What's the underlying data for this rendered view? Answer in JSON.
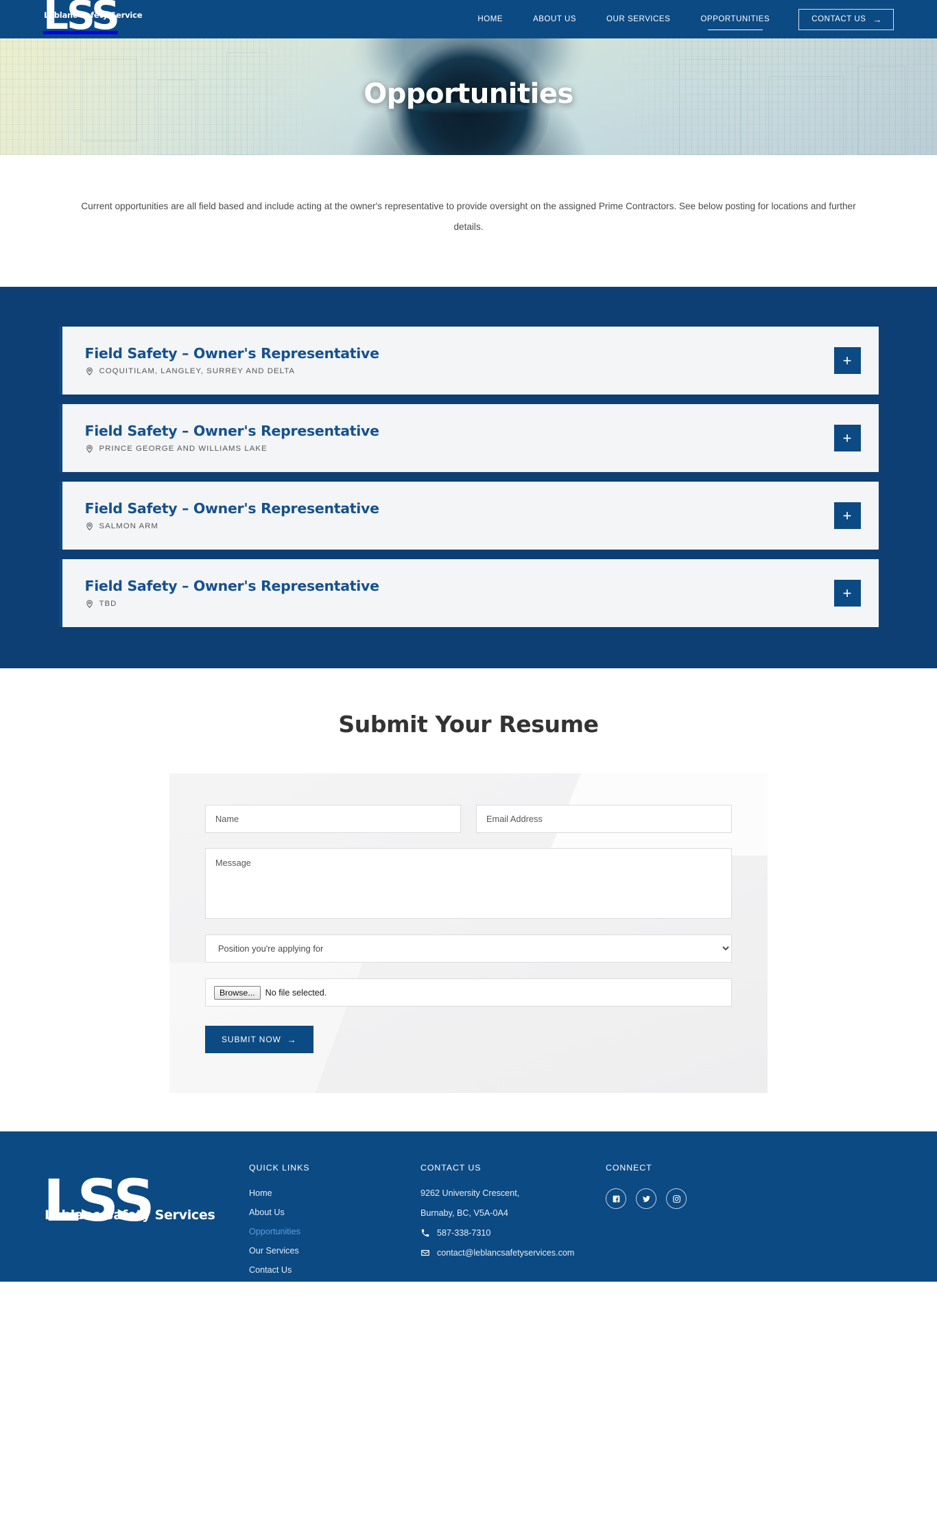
{
  "header": {
    "logo_main": "LSS",
    "logo_sub": "Leblanc Safety Services",
    "nav": [
      {
        "label": "HOME",
        "active": false
      },
      {
        "label": "ABOUT US",
        "active": false
      },
      {
        "label": "OUR SERVICES",
        "active": false
      },
      {
        "label": "OPPORTUNITIES",
        "active": true
      }
    ],
    "cta_label": "CONTACT US",
    "cta_arrow": "→"
  },
  "hero": {
    "title": "Opportunities"
  },
  "intro": {
    "paragraph": "Current opportunities are all field based and include acting at the owner's representative to provide oversight on the assigned Prime Contractors.  See below posting for locations and further details."
  },
  "jobs": [
    {
      "title": "Field Safety – Owner's Representative",
      "location": "COQUITILAM, LANGLEY, SURREY AND DELTA",
      "expand_label": "+"
    },
    {
      "title": "Field Safety – Owner's Representative",
      "location": "PRINCE GEORGE AND WILLIAMS LAKE",
      "expand_label": "+"
    },
    {
      "title": "Field Safety – Owner's Representative",
      "location": "SALMON ARM",
      "expand_label": "+"
    },
    {
      "title": "Field Safety – Owner's Representative",
      "location": "TBD",
      "expand_label": "+"
    }
  ],
  "resume": {
    "heading": "Submit Your Resume",
    "name_placeholder": "Name",
    "name_value": "",
    "email_placeholder": "Email Address",
    "email_value": "",
    "message_placeholder": "Message",
    "message_value": "",
    "position_selected": "Position you're applying for",
    "position_options": [
      "Position you're applying for"
    ],
    "file_browse_label": "Browse...",
    "file_status": "No file selected.",
    "submit_label": "SUBMIT NOW",
    "submit_arrow": "→"
  },
  "footer": {
    "logo_main": "LSS",
    "logo_sub": "Leblanc Safety Services",
    "quick_links_heading": "QUICK LINKS",
    "quick_links": [
      {
        "label": "Home",
        "active": false
      },
      {
        "label": "About Us",
        "active": false
      },
      {
        "label": "Opportunities",
        "active": true
      },
      {
        "label": "Our Services",
        "active": false
      },
      {
        "label": "Contact Us",
        "active": false
      }
    ],
    "contact_heading": "CONTACT US",
    "address_line1": "9262 University Crescent,",
    "address_line2": "Burnaby, BC, V5A-0A4",
    "phone": "587-338-7310",
    "email": "contact@leblancsafetyservices.com",
    "connect_heading": "CONNECT",
    "socials": [
      "facebook",
      "twitter",
      "instagram"
    ]
  },
  "colors": {
    "brand_blue": "#0c4a84",
    "section_blue": "#0d3f74",
    "job_title_blue": "#15518f",
    "active_link_blue": "#5c9ddb"
  }
}
